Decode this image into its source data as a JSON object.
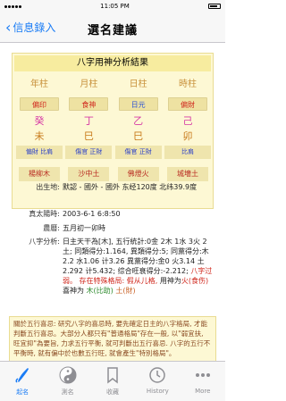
{
  "status": {
    "carrier_dots": 5,
    "time": "11:05 PM"
  },
  "nav": {
    "back_label": "信息錄入",
    "title": "選名建議"
  },
  "panel": {
    "title": "八字用神分析結果",
    "pillars": [
      {
        "head": "年柱",
        "ten_god": "偏印",
        "stem": "癸",
        "branch": "未",
        "hidden": "偏財 比肩",
        "nayin": "楊柳木",
        "ten_god_color": "#d0281d"
      },
      {
        "head": "月柱",
        "ten_god": "食神",
        "stem": "丁",
        "branch": "巳",
        "hidden": "傷官 正財",
        "nayin": "沙中土",
        "ten_god_color": "#d0281d"
      },
      {
        "head": "日柱",
        "ten_god": "日元",
        "stem": "乙",
        "branch": "巳",
        "hidden": "傷官 正財",
        "nayin": "佛燈火",
        "ten_god_color": "#2b52d6"
      },
      {
        "head": "時柱",
        "ten_god": "偏財",
        "stem": "己",
        "branch": "卯",
        "hidden": "比肩",
        "nayin": "城墻土",
        "ten_god_color": "#d0281d"
      }
    ]
  },
  "info": {
    "birthplace_label": "出生地:",
    "birthplace_value": "默認 - 國外 - 國外 东经120度 北纬39.9度",
    "solar_label": "真太陽時:",
    "solar_value": "2003-6-1 6:8:50",
    "lunar_label": "農曆:",
    "lunar_value": "五月初一卯時",
    "analysis_label": "八字分析:",
    "analysis_text": "日主天干為[木], 五行統計:0金 2木 1水 3火 2土; 同類得分:1.164, 異類得分:5;",
    "analysis_text2": "同黨得分:木2.2 水1.06 计3.26 異黨得分:金0 火3.14 土2.292 计5.432; 综合旺衰得分:-2.212;",
    "analysis_weak": "八字过弱。",
    "analysis_pattern": "存在特殊格局: 假从儿格,",
    "analysis_use": "用神为",
    "analysis_use_val": "火(食伤)",
    "analysis_joy": "喜神为",
    "analysis_joy_val": "木(比助)",
    "analysis_earth": "土(財)"
  },
  "note": {
    "text": "關於五行喜忌: 研究八字的喜忌時, 要先確定日主的八字格局, 才能判斷五行喜忌。大部分人都只有\"普通格局\"存在一般, 以\"弱宜扶, 旺宜抑\"為要旨, 力求五行平衡, 就可判斷出五行喜忌. 八字的五行不平衡時, 就有偏中於也數五行旺, 就會產生\"特別格局\"。"
  },
  "tabs": [
    {
      "label": "起名",
      "icon": "name-pen-icon"
    },
    {
      "label": "測名",
      "icon": "yin-yang-icon"
    },
    {
      "label": "收藏",
      "icon": "bookmark-icon"
    },
    {
      "label": "History",
      "icon": "history-clock-icon"
    },
    {
      "label": "More",
      "icon": "more-dots-icon"
    }
  ],
  "colors": {
    "accent": "#1a7cf5",
    "panel_bg": "#fdf8d4",
    "panel_header": "#f7ec9f"
  }
}
